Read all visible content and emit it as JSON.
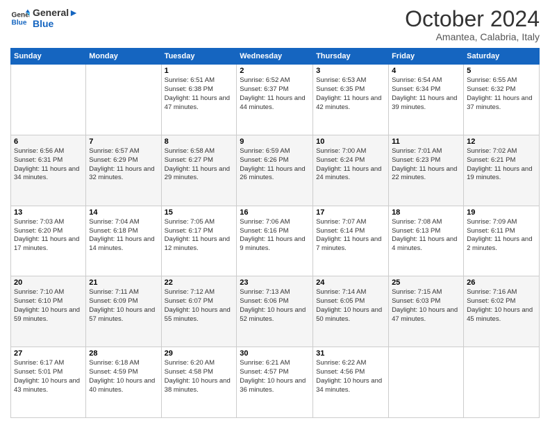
{
  "header": {
    "logo": {
      "line1": "General",
      "line2": "Blue"
    },
    "title": "October 2024",
    "subtitle": "Amantea, Calabria, Italy"
  },
  "weekdays": [
    "Sunday",
    "Monday",
    "Tuesday",
    "Wednesday",
    "Thursday",
    "Friday",
    "Saturday"
  ],
  "weeks": [
    [
      {
        "day": "",
        "info": ""
      },
      {
        "day": "",
        "info": ""
      },
      {
        "day": "1",
        "info": "Sunrise: 6:51 AM\nSunset: 6:38 PM\nDaylight: 11 hours and 47 minutes."
      },
      {
        "day": "2",
        "info": "Sunrise: 6:52 AM\nSunset: 6:37 PM\nDaylight: 11 hours and 44 minutes."
      },
      {
        "day": "3",
        "info": "Sunrise: 6:53 AM\nSunset: 6:35 PM\nDaylight: 11 hours and 42 minutes."
      },
      {
        "day": "4",
        "info": "Sunrise: 6:54 AM\nSunset: 6:34 PM\nDaylight: 11 hours and 39 minutes."
      },
      {
        "day": "5",
        "info": "Sunrise: 6:55 AM\nSunset: 6:32 PM\nDaylight: 11 hours and 37 minutes."
      }
    ],
    [
      {
        "day": "6",
        "info": "Sunrise: 6:56 AM\nSunset: 6:31 PM\nDaylight: 11 hours and 34 minutes."
      },
      {
        "day": "7",
        "info": "Sunrise: 6:57 AM\nSunset: 6:29 PM\nDaylight: 11 hours and 32 minutes."
      },
      {
        "day": "8",
        "info": "Sunrise: 6:58 AM\nSunset: 6:27 PM\nDaylight: 11 hours and 29 minutes."
      },
      {
        "day": "9",
        "info": "Sunrise: 6:59 AM\nSunset: 6:26 PM\nDaylight: 11 hours and 26 minutes."
      },
      {
        "day": "10",
        "info": "Sunrise: 7:00 AM\nSunset: 6:24 PM\nDaylight: 11 hours and 24 minutes."
      },
      {
        "day": "11",
        "info": "Sunrise: 7:01 AM\nSunset: 6:23 PM\nDaylight: 11 hours and 22 minutes."
      },
      {
        "day": "12",
        "info": "Sunrise: 7:02 AM\nSunset: 6:21 PM\nDaylight: 11 hours and 19 minutes."
      }
    ],
    [
      {
        "day": "13",
        "info": "Sunrise: 7:03 AM\nSunset: 6:20 PM\nDaylight: 11 hours and 17 minutes."
      },
      {
        "day": "14",
        "info": "Sunrise: 7:04 AM\nSunset: 6:18 PM\nDaylight: 11 hours and 14 minutes."
      },
      {
        "day": "15",
        "info": "Sunrise: 7:05 AM\nSunset: 6:17 PM\nDaylight: 11 hours and 12 minutes."
      },
      {
        "day": "16",
        "info": "Sunrise: 7:06 AM\nSunset: 6:16 PM\nDaylight: 11 hours and 9 minutes."
      },
      {
        "day": "17",
        "info": "Sunrise: 7:07 AM\nSunset: 6:14 PM\nDaylight: 11 hours and 7 minutes."
      },
      {
        "day": "18",
        "info": "Sunrise: 7:08 AM\nSunset: 6:13 PM\nDaylight: 11 hours and 4 minutes."
      },
      {
        "day": "19",
        "info": "Sunrise: 7:09 AM\nSunset: 6:11 PM\nDaylight: 11 hours and 2 minutes."
      }
    ],
    [
      {
        "day": "20",
        "info": "Sunrise: 7:10 AM\nSunset: 6:10 PM\nDaylight: 10 hours and 59 minutes."
      },
      {
        "day": "21",
        "info": "Sunrise: 7:11 AM\nSunset: 6:09 PM\nDaylight: 10 hours and 57 minutes."
      },
      {
        "day": "22",
        "info": "Sunrise: 7:12 AM\nSunset: 6:07 PM\nDaylight: 10 hours and 55 minutes."
      },
      {
        "day": "23",
        "info": "Sunrise: 7:13 AM\nSunset: 6:06 PM\nDaylight: 10 hours and 52 minutes."
      },
      {
        "day": "24",
        "info": "Sunrise: 7:14 AM\nSunset: 6:05 PM\nDaylight: 10 hours and 50 minutes."
      },
      {
        "day": "25",
        "info": "Sunrise: 7:15 AM\nSunset: 6:03 PM\nDaylight: 10 hours and 47 minutes."
      },
      {
        "day": "26",
        "info": "Sunrise: 7:16 AM\nSunset: 6:02 PM\nDaylight: 10 hours and 45 minutes."
      }
    ],
    [
      {
        "day": "27",
        "info": "Sunrise: 6:17 AM\nSunset: 5:01 PM\nDaylight: 10 hours and 43 minutes."
      },
      {
        "day": "28",
        "info": "Sunrise: 6:18 AM\nSunset: 4:59 PM\nDaylight: 10 hours and 40 minutes."
      },
      {
        "day": "29",
        "info": "Sunrise: 6:20 AM\nSunset: 4:58 PM\nDaylight: 10 hours and 38 minutes."
      },
      {
        "day": "30",
        "info": "Sunrise: 6:21 AM\nSunset: 4:57 PM\nDaylight: 10 hours and 36 minutes."
      },
      {
        "day": "31",
        "info": "Sunrise: 6:22 AM\nSunset: 4:56 PM\nDaylight: 10 hours and 34 minutes."
      },
      {
        "day": "",
        "info": ""
      },
      {
        "day": "",
        "info": ""
      }
    ]
  ]
}
